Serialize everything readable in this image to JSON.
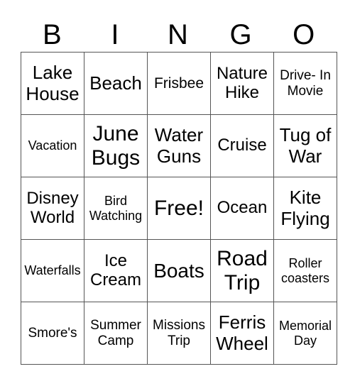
{
  "header": [
    "B",
    "I",
    "N",
    "G",
    "O"
  ],
  "rows": [
    [
      {
        "text": "Lake House",
        "size": "s26"
      },
      {
        "text": "Beach",
        "size": "s26"
      },
      {
        "text": "Frisbee",
        "size": "s20"
      },
      {
        "text": "Nature Hike",
        "size": "s24"
      },
      {
        "text": "Drive- In Movie",
        "size": "s19"
      }
    ],
    [
      {
        "text": "Vacation",
        "size": "s18"
      },
      {
        "text": "June Bugs",
        "size": "s30"
      },
      {
        "text": "Water Guns",
        "size": "s26"
      },
      {
        "text": "Cruise",
        "size": "s24"
      },
      {
        "text": "Tug of War",
        "size": "s26"
      }
    ],
    [
      {
        "text": "Disney World",
        "size": "s24"
      },
      {
        "text": "Bird Watching",
        "size": "s18"
      },
      {
        "text": "Free!",
        "size": "s30"
      },
      {
        "text": "Ocean",
        "size": "s24"
      },
      {
        "text": "Kite Flying",
        "size": "s26"
      }
    ],
    [
      {
        "text": "Waterfalls",
        "size": "s18"
      },
      {
        "text": "Ice Cream",
        "size": "s24"
      },
      {
        "text": "Boats",
        "size": "s28"
      },
      {
        "text": "Road Trip",
        "size": "s30"
      },
      {
        "text": "Roller coasters",
        "size": "s18"
      }
    ],
    [
      {
        "text": "Smore's",
        "size": "s19"
      },
      {
        "text": "Summer Camp",
        "size": "s19"
      },
      {
        "text": "Missions Trip",
        "size": "s19"
      },
      {
        "text": "Ferris Wheel",
        "size": "s26"
      },
      {
        "text": "Memorial Day",
        "size": "s18"
      }
    ]
  ]
}
